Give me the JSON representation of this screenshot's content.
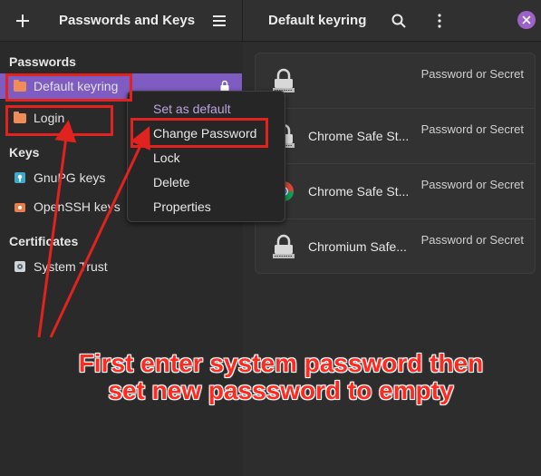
{
  "header": {
    "app_title": "Passwords and Keys",
    "keyring_title": "Default keyring",
    "icons": {
      "add": "plus-icon",
      "menu": "hamburger-menu-icon",
      "search": "search-icon",
      "more": "vertical-dots-icon",
      "close": "close-icon"
    }
  },
  "sidebar": {
    "sections": {
      "passwords": "Passwords",
      "keys": "Keys",
      "certificates": "Certificates"
    },
    "items": {
      "default_keyring": "Default keyring",
      "login": "Login",
      "gnupg": "GnuPG keys",
      "openssh": "OpenSSH keys",
      "system_trust": "System Trust"
    }
  },
  "context_menu": {
    "items": [
      "Set as default",
      "Change Password",
      "Lock",
      "Delete",
      "Properties"
    ]
  },
  "secrets": {
    "rows": [
      {
        "name": "",
        "type": "Password or Secret",
        "icon": "lock-icon"
      },
      {
        "name": "Chrome Safe St...",
        "type": "Password or Secret",
        "icon": "lock-icon"
      },
      {
        "name": "Chrome Safe St...",
        "type": "Password or Secret",
        "icon": "chrome-icon"
      },
      {
        "name": "Chromium Safe...",
        "type": "Password or Secret",
        "icon": "lock-icon"
      }
    ]
  },
  "annotation": {
    "line1": "First enter system password then",
    "line2": "set new passsword to empty"
  },
  "colors": {
    "accent": "#7f5cc2",
    "annotation": "#e0231f",
    "folder": "#f08c5a",
    "close": "#9d62c8"
  }
}
